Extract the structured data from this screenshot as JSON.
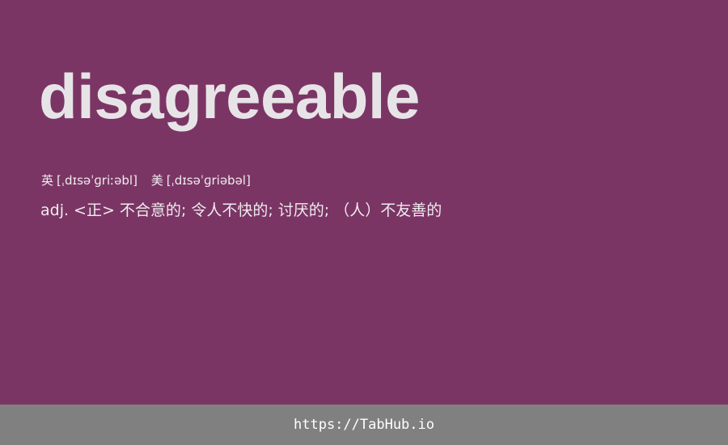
{
  "entry": {
    "word": "disagreeable",
    "phonetics": [
      {
        "label": "英",
        "ipa": "[ˌdɪsəˈɡriːəbl]"
      },
      {
        "label": "美",
        "ipa": "[ˌdɪsəˈɡriəbəl]"
      }
    ],
    "definition": {
      "pos": "adj.",
      "text": "<正> 不合意的; 令人不快的; 讨厌的; （人）不友善的"
    }
  },
  "footer": {
    "link_text": "https://TabHub.io"
  },
  "colors": {
    "background": "#7b3565",
    "footer_background": "#808080",
    "word_text": "#e7e4e7",
    "body_text": "#f0ecef"
  }
}
